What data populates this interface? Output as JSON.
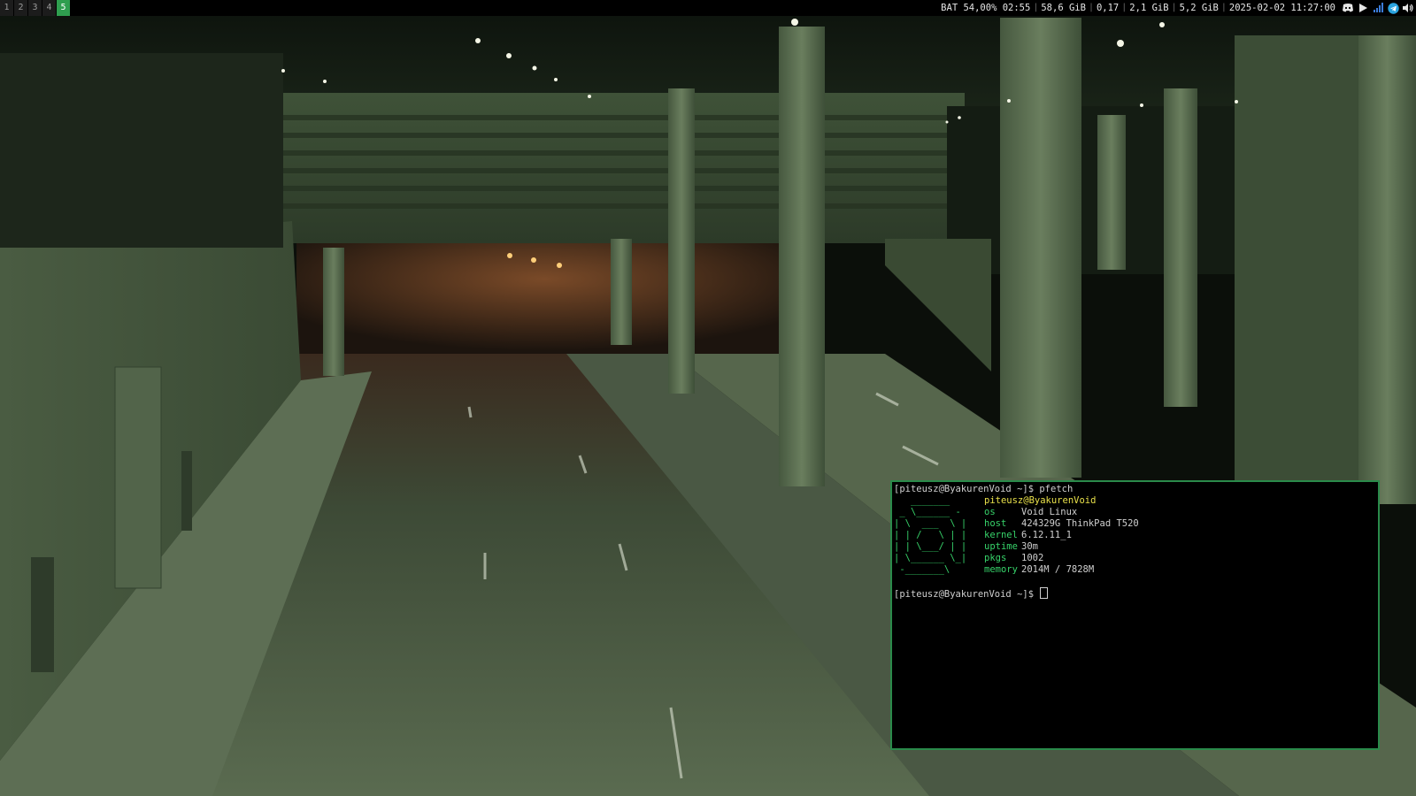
{
  "workspaces": [
    {
      "label": "1",
      "active": false
    },
    {
      "label": "2",
      "active": false
    },
    {
      "label": "3",
      "active": false
    },
    {
      "label": "4",
      "active": false
    },
    {
      "label": "5",
      "active": true
    }
  ],
  "status": {
    "battery": "BAT 54,00% 02:55",
    "disk": "58,6 GiB",
    "load": "0,17",
    "mem": "2,1 GiB",
    "swap": "5,2 GiB",
    "datetime": "2025-02-02 11:27:00",
    "tray_icons": [
      "discord-icon",
      "play-icon",
      "signal-icon",
      "telegram-icon",
      "volume-icon"
    ]
  },
  "terminal": {
    "prompt1": "[piteusz@ByakurenVoid ~]$ pfetch",
    "ascii": [
      "   _______",
      " _ \\______ -",
      "| \\  ___  \\ |",
      "| | /   \\ | |",
      "| | \\___/ | |",
      "| \\______ \\_|",
      " -_______\\"
    ],
    "user_host": "piteusz@ByakurenVoid",
    "info": [
      {
        "key": "os",
        "value": "Void Linux"
      },
      {
        "key": "host",
        "value": "424329G ThinkPad T520"
      },
      {
        "key": "kernel",
        "value": "6.12.11_1"
      },
      {
        "key": "uptime",
        "value": "30m"
      },
      {
        "key": "pkgs",
        "value": "1002"
      },
      {
        "key": "memory",
        "value": "2014M / 7828M"
      }
    ],
    "prompt2": "[piteusz@ByakurenVoid ~]$ "
  },
  "colors": {
    "accent": "#2f9e4f",
    "terminal_border": "#2a8a4a",
    "pfetch_green": "#37d36a",
    "pfetch_yellow": "#e8e04a"
  }
}
